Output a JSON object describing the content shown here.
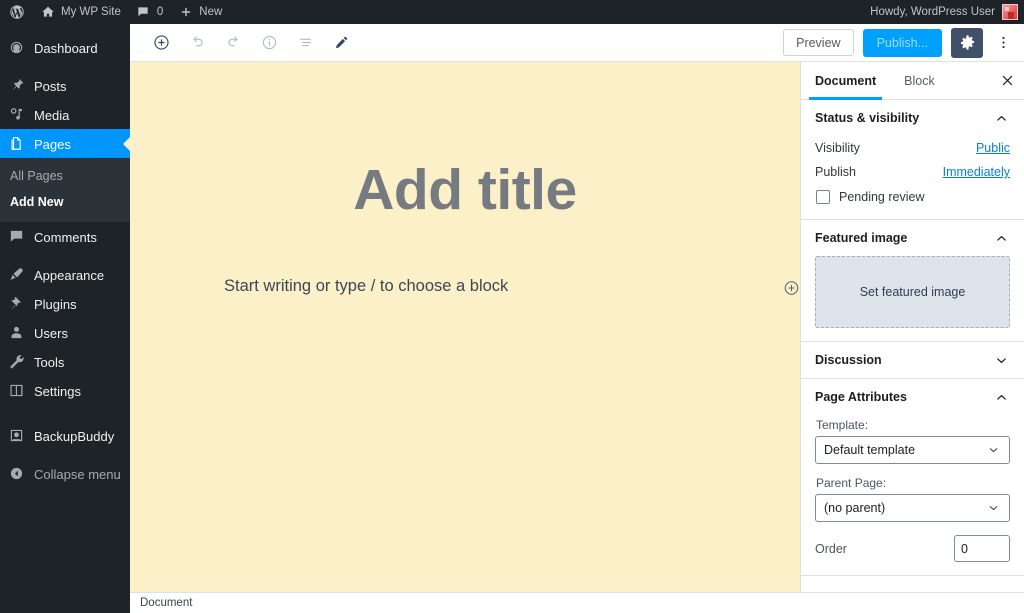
{
  "adminbar": {
    "logo_icon": "wordpress-logo-icon",
    "site_name": "My WP Site",
    "home_icon": "home-icon",
    "comment_icon": "comment-bubble-icon",
    "comment_count": "0",
    "new_icon": "plus-icon",
    "new_label": "New",
    "howdy": "Howdy, WordPress User",
    "avatar_icon": "user-avatar-icon"
  },
  "sidebar": {
    "items": [
      {
        "label": "Dashboard",
        "icon": "dashboard-icon",
        "current": false
      },
      {
        "label": "Posts",
        "icon": "pin-icon",
        "current": false
      },
      {
        "label": "Media",
        "icon": "media-icon",
        "current": false
      },
      {
        "label": "Pages",
        "icon": "pages-icon",
        "current": true
      },
      {
        "label": "Comments",
        "icon": "comment-bubble-icon",
        "current": false
      },
      {
        "label": "Appearance",
        "icon": "paintbrush-icon",
        "current": false
      },
      {
        "label": "Plugins",
        "icon": "plugin-icon",
        "current": false
      },
      {
        "label": "Users",
        "icon": "user-icon",
        "current": false
      },
      {
        "label": "Tools",
        "icon": "wrench-icon",
        "current": false
      },
      {
        "label": "Settings",
        "icon": "settings-sliders-icon",
        "current": false
      },
      {
        "label": "BackupBuddy",
        "icon": "backupbuddy-icon",
        "current": false
      }
    ],
    "submenu": [
      {
        "label": "All Pages",
        "current": false
      },
      {
        "label": "Add New",
        "current": true
      }
    ],
    "collapse_label": "Collapse menu",
    "collapse_icon": "collapse-arrow-icon",
    "highlight_color": "#0096ff",
    "background_color": "#1d2327"
  },
  "toolbar": {
    "add_block_icon": "circle-plus-icon",
    "undo_icon": "undo-arrow-icon",
    "redo_icon": "redo-arrow-icon",
    "info_icon": "circle-info-icon",
    "list_view_icon": "list-view-icon",
    "edit_icon": "pencil-icon",
    "preview_label": "Preview",
    "publish_label": "Publish...",
    "settings_icon": "gear-icon",
    "more_icon": "three-dots-vertical-icon",
    "publish_color": "#00a0ff"
  },
  "canvas": {
    "title_placeholder": "Add title",
    "block_placeholder": "Start writing or type / to choose a block",
    "appender_icon": "circle-plus-icon",
    "background_color": "#fcf0c8"
  },
  "settings_panel": {
    "tabs": [
      {
        "label": "Document",
        "active": true
      },
      {
        "label": "Block",
        "active": false
      }
    ],
    "close_icon": "close-x-icon",
    "status_visibility": {
      "title": "Status & visibility",
      "chevron_icon": "chevron-up-icon",
      "visibility_label": "Visibility",
      "visibility_value": "Public",
      "publish_label": "Publish",
      "publish_value": "Immediately",
      "pending_review_label": "Pending review",
      "pending_review_checked": false
    },
    "featured_image": {
      "title": "Featured image",
      "chevron_icon": "chevron-up-icon",
      "set_label": "Set featured image"
    },
    "discussion": {
      "title": "Discussion",
      "chevron_icon": "chevron-down-icon"
    },
    "page_attributes": {
      "title": "Page Attributes",
      "chevron_icon": "chevron-up-icon",
      "template_label": "Template:",
      "template_value": "Default template",
      "parent_label": "Parent Page:",
      "parent_value": "(no parent)",
      "order_label": "Order",
      "order_value": "0"
    }
  },
  "breadcrumb": {
    "label": "Document"
  }
}
